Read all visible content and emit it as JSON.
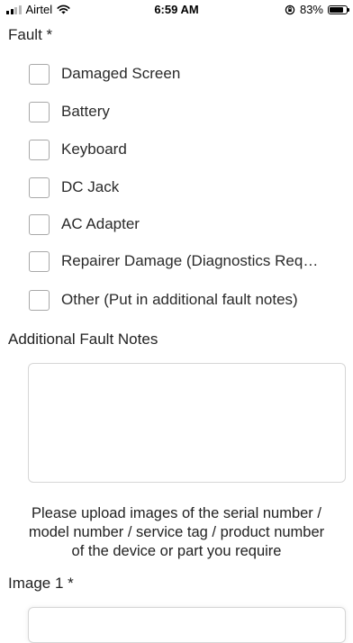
{
  "status_bar": {
    "carrier": "Airtel",
    "time": "6:59 AM",
    "battery": "83%",
    "battery_level": 0.83
  },
  "form": {
    "fault_label": "Fault *",
    "fault_options": [
      "Damaged Screen",
      "Battery",
      "Keyboard",
      "DC Jack",
      "AC Adapter",
      "Repairer Damage (Diagnostics Requir...",
      "Other (Put in additional fault notes)"
    ],
    "notes_label": "Additional Fault Notes",
    "notes_value": "",
    "upload_info_lines": [
      "Please upload images of the serial number /",
      "model number / service tag / product number",
      "of the device or part you require"
    ],
    "image1_label": "Image 1 *"
  }
}
